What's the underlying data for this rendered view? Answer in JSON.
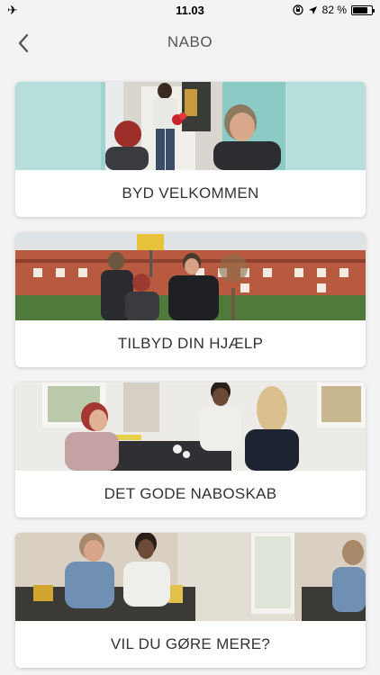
{
  "status_bar": {
    "time": "11.03",
    "battery": "82 %",
    "battery_level": 0.82,
    "left_icon": "airplane-icon",
    "right_icons": [
      "orientation-lock-icon",
      "location-arrow-icon",
      "battery-icon"
    ]
  },
  "nav": {
    "title": "NABO",
    "back_icon": "chevron-left-icon"
  },
  "cards": [
    {
      "label": "BYD VELKOMMEN"
    },
    {
      "label": "TILBYD DIN HJÆLP"
    },
    {
      "label": "DET GODE NABOSKAB"
    },
    {
      "label": "VIL DU GØRE MERE?"
    }
  ]
}
